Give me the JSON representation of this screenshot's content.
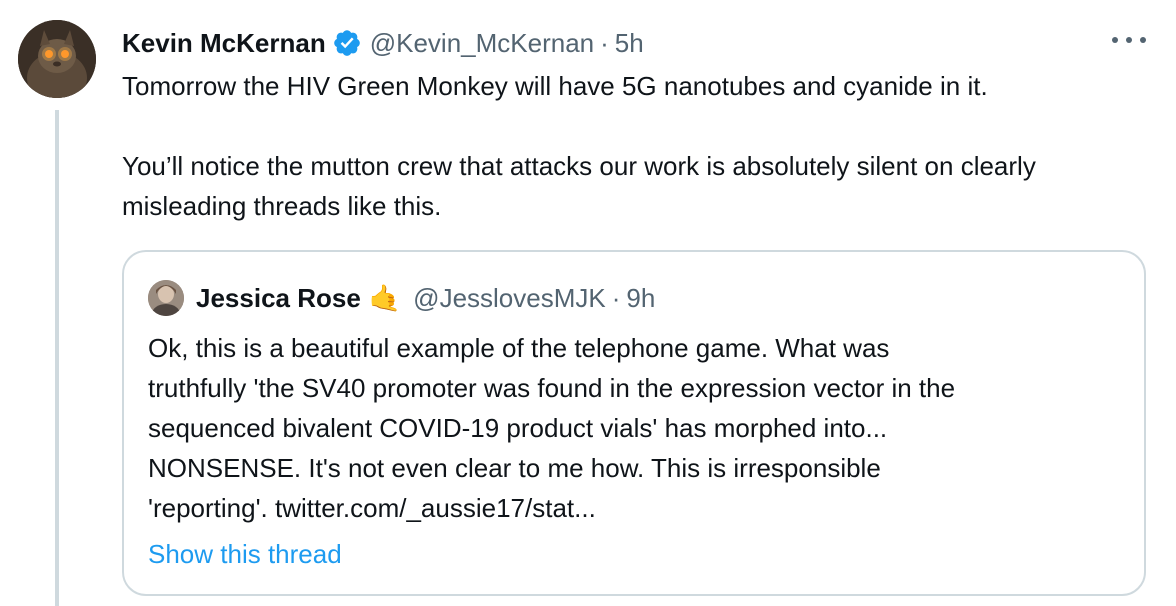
{
  "tweet": {
    "author": {
      "display_name": "Kevin McKernan",
      "handle": "@Kevin_McKernan",
      "verified": true,
      "avatar_icon": "cat-avatar"
    },
    "separator": "·",
    "time": "5h",
    "more_icon": "more-horizontal-icon",
    "text": [
      "Tomorrow the HIV Green Monkey will have 5G nanotubes and cyanide in it.",
      "You’ll notice the mutton crew that attacks our work is absolutely silent on clearly misleading threads like this."
    ],
    "quote": {
      "author": {
        "display_name": "Jessica Rose",
        "emoji": "🤙",
        "handle": "@JesslovesMJK"
      },
      "separator": "·",
      "time": "9h",
      "text_lines": [
        "Ok, this is a beautiful example of the telephone game. What was",
        "truthfully 'the SV40 promoter was found in the expression vector in the",
        "sequenced bivalent COVID-19 product vials' has morphed into...",
        "NONSENSE. It's not even clear to me how. This is irresponsible",
        "'reporting'. twitter.com/_aussie17/stat..."
      ],
      "show_thread_label": "Show this thread"
    }
  },
  "colors": {
    "text_primary": "#0f1419",
    "text_secondary": "#536471",
    "link_blue": "#1d9bf0",
    "border": "#cfd9de",
    "verified_blue": "#1d9bf0"
  }
}
